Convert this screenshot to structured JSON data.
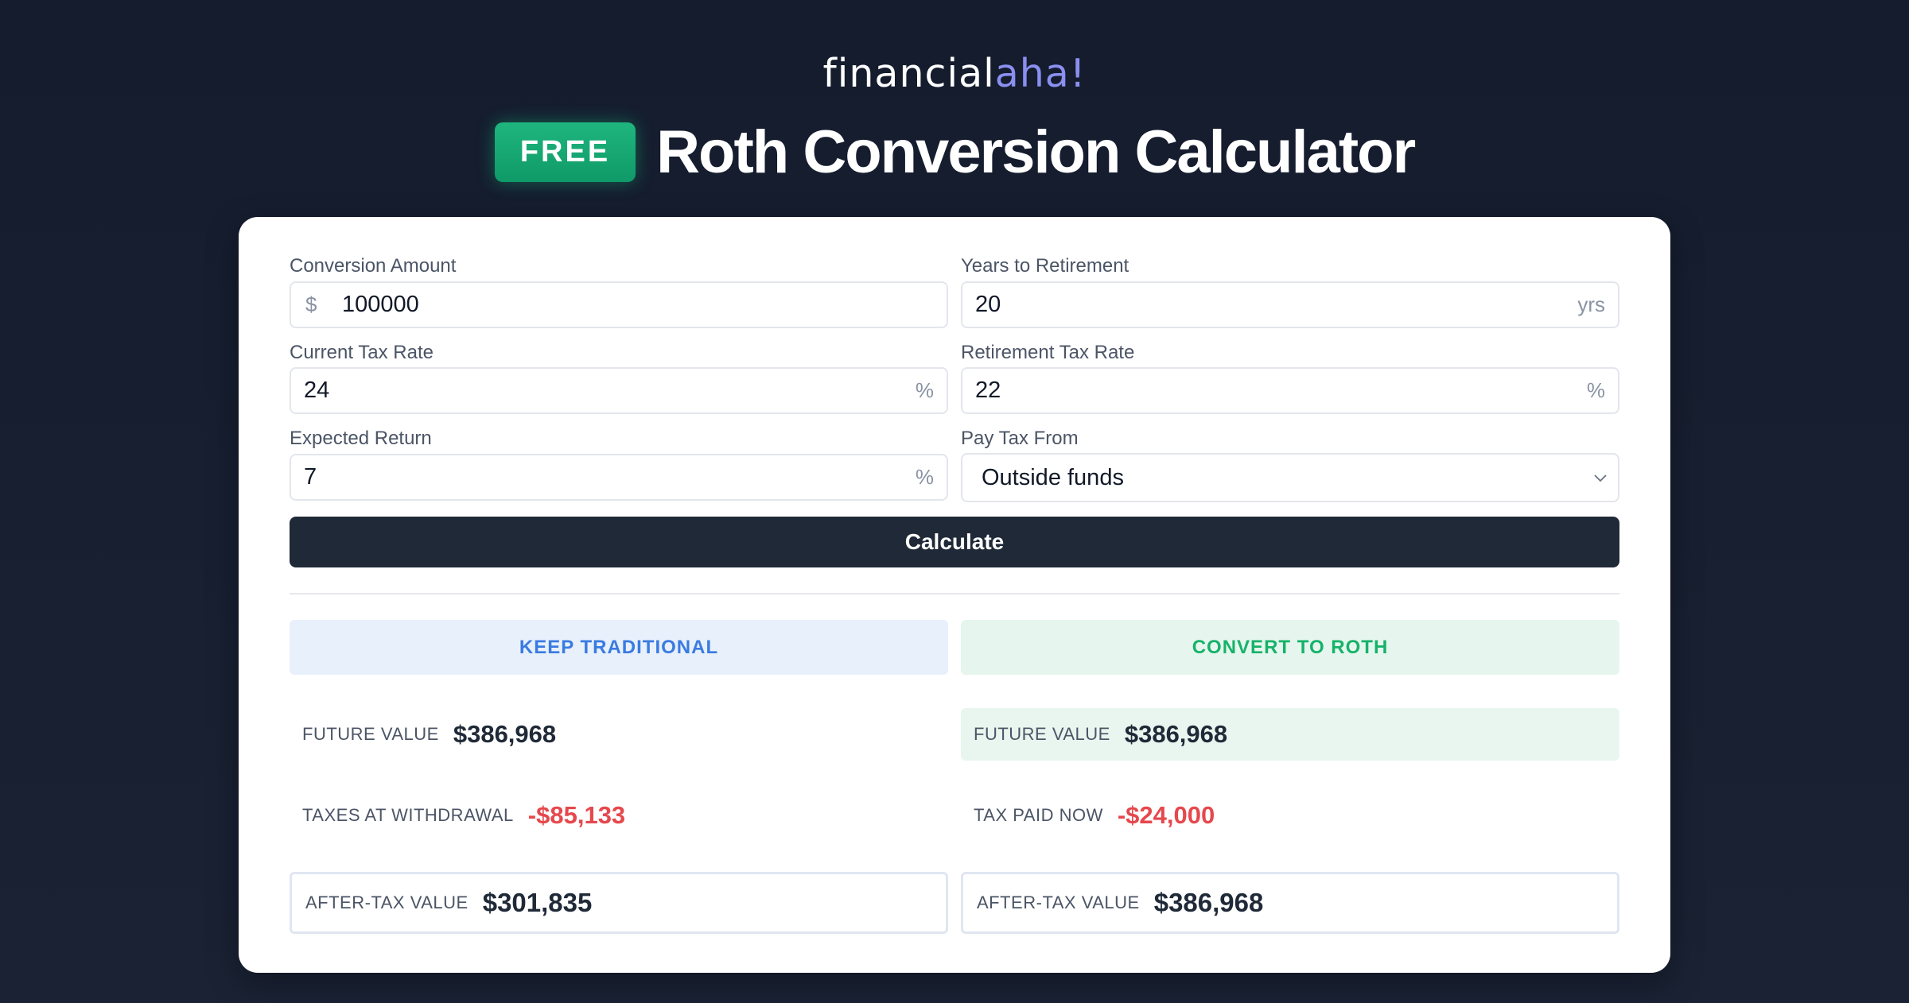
{
  "brand": {
    "main": "financial",
    "accent": "aha!"
  },
  "header": {
    "badge": "FREE",
    "title": "Roth Conversion Calculator"
  },
  "form": {
    "conversion_amount": {
      "label": "Conversion Amount",
      "prefix": "$",
      "value": "100000"
    },
    "years_to_retirement": {
      "label": "Years to Retirement",
      "value": "20",
      "suffix": "yrs"
    },
    "current_tax_rate": {
      "label": "Current Tax Rate",
      "value": "24",
      "suffix": "%"
    },
    "retirement_tax_rate": {
      "label": "Retirement Tax Rate",
      "value": "22",
      "suffix": "%"
    },
    "expected_return": {
      "label": "Expected Return",
      "value": "7",
      "suffix": "%"
    },
    "pay_tax_from": {
      "label": "Pay Tax From",
      "value": "Outside funds"
    },
    "calculate_label": "Calculate"
  },
  "results": {
    "traditional": {
      "heading": "KEEP TRADITIONAL",
      "future_value": {
        "label": "FUTURE VALUE",
        "value": "$386,968"
      },
      "taxes": {
        "label": "TAXES AT WITHDRAWAL",
        "value": "-$85,133"
      },
      "after_tax": {
        "label": "AFTER-TAX VALUE",
        "value": "$301,835"
      }
    },
    "roth": {
      "heading": "CONVERT TO ROTH",
      "future_value": {
        "label": "FUTURE VALUE",
        "value": "$386,968"
      },
      "taxes": {
        "label": "TAX PAID NOW",
        "value": "-$24,000"
      },
      "after_tax": {
        "label": "AFTER-TAX VALUE",
        "value": "$386,968"
      }
    }
  },
  "colors": {
    "background": "#141c2e",
    "brand_accent": "#8b8ff0",
    "badge_green": "#16a673",
    "button_dark": "#1f2937",
    "traditional_blue": "#3a7be0",
    "roth_green": "#17b26a",
    "negative_red": "#e5484d"
  },
  "icons": {
    "select_arrow": "chevron-down-icon"
  }
}
